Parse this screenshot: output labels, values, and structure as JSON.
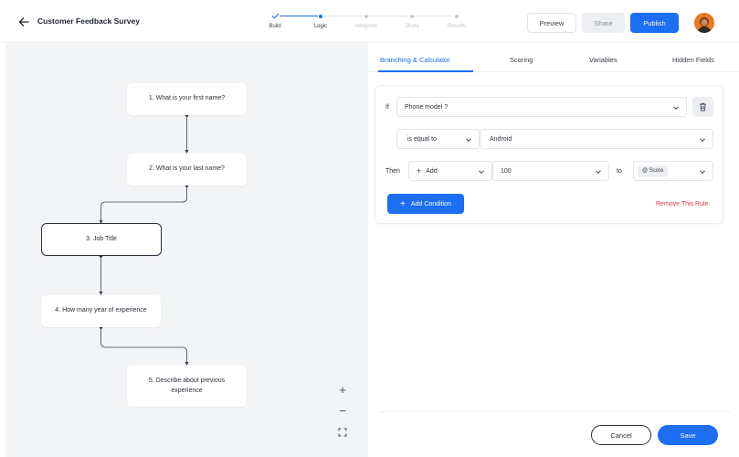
{
  "header": {
    "title": "Customer Feedback Survey",
    "steps": [
      {
        "label": "Build",
        "state": "done"
      },
      {
        "label": "Logic",
        "state": "active"
      },
      {
        "label": "Integrate",
        "state": "pending"
      },
      {
        "label": "Share",
        "state": "pending"
      },
      {
        "label": "Results",
        "state": "pending"
      }
    ],
    "preview_label": "Preview",
    "share_label": "Share",
    "publish_label": "Publish",
    "accent_color": "#1c6ef2"
  },
  "flow": {
    "nodes": [
      {
        "label": "1. What is your first name?"
      },
      {
        "label": "2. What is your last name?"
      },
      {
        "label": "3. Job Title",
        "selected": true
      },
      {
        "label": "4. How many year of experience"
      },
      {
        "label": "5. Describe about previous experience"
      }
    ],
    "zoom_in": "+",
    "zoom_out": "−",
    "fit_icon": "fit-screen-icon"
  },
  "panel": {
    "tabs": [
      {
        "label": "Branching & Calculator",
        "active": true
      },
      {
        "label": "Scoring"
      },
      {
        "label": "Variables"
      },
      {
        "label": "Hidden Fields"
      }
    ],
    "rule": {
      "if_label": "If",
      "question": "Phone model ?",
      "operator": "is equal to",
      "value": "Android",
      "then_label": "Then",
      "action": "Add",
      "amount": "100",
      "to_label": "to",
      "target": "@ Score",
      "add_condition_label": "Add Condition",
      "remove_rule_label": "Remove This Rule"
    },
    "cancel_label": "Cancel",
    "save_label": "Save",
    "danger_color": "#e0393e"
  }
}
